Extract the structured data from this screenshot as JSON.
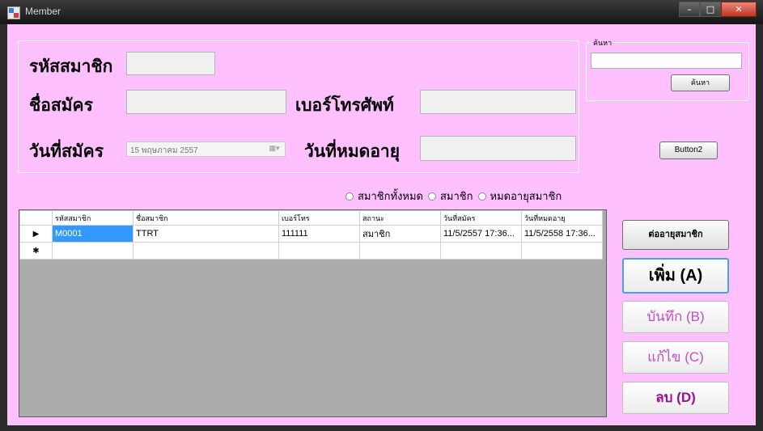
{
  "window": {
    "title": "Member",
    "min": "–",
    "max": "□",
    "close": "✕"
  },
  "form": {
    "member_id_label": "รหัสสมาชิก",
    "name_label": "ชื่อสมัคร",
    "phone_label": "เบอร์โทรศัพท์",
    "reg_date_label": "วันที่สมัคร",
    "exp_date_label": "วันที่หมดอายุ",
    "reg_date_value": "15 พฤษภาคม   2557",
    "date_dropdown": "▦▾"
  },
  "search": {
    "group_title": "ค้นหา",
    "button": "ค้นหา"
  },
  "button2": "Button2",
  "filters": [
    "สมาชิกทั้งหมด",
    "สมาชิก",
    "หมดอายุสมาชิก"
  ],
  "grid": {
    "columns": [
      "รหัสสมาชิก",
      "ชื่อสมาชิก",
      "เบอร์โทร",
      "สถานะ",
      "วันที่สมัคร",
      "วันที่หมดอายุ"
    ],
    "rows": [
      [
        "M0001",
        "TTRT",
        "111111",
        "สมาชิก",
        "11/5/2557 17:36...",
        "11/5/2558 17:36..."
      ]
    ],
    "current_row_marker": "▶",
    "new_row_marker": "✱"
  },
  "actions": {
    "renew": "ต่ออายุสมาชิก",
    "add": "เพิ่ม (A)",
    "save": "บันทึก (B)",
    "edit": "แก้ไข (C)",
    "delete": "ลบ (D)"
  }
}
